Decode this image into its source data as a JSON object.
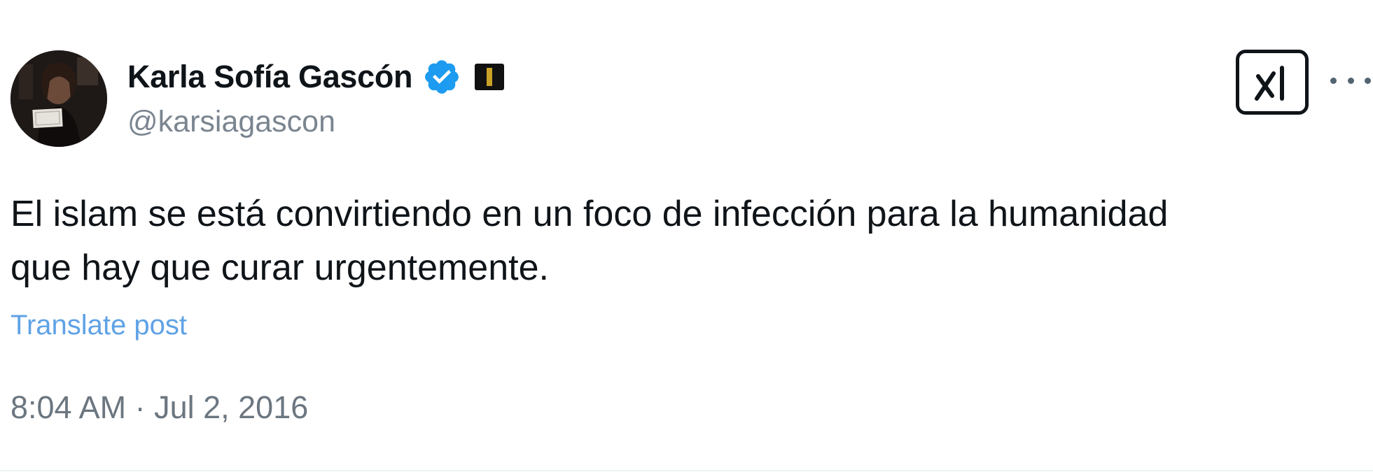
{
  "tweet": {
    "author": {
      "display_name": "Karla Sofía Gascón",
      "handle": "@karsiagascon",
      "verified": true,
      "badge_icon": "verified-badge-icon",
      "affiliate_icon": "flag-icon"
    },
    "text_lines": [
      "El islam se está convirtiendo en un foco de infección para la humanidad",
      "que hay que curar urgentemente."
    ],
    "translate_label": "Translate post",
    "timestamp": "8:04 AM · Jul 2, 2016"
  },
  "actions": {
    "grok_icon": "grok-icon",
    "more_icon": "more-options-icon"
  },
  "colors": {
    "text": "#0f1419",
    "secondary": "#7a8590",
    "link": "#5fa2e6",
    "verified": "#1d9bf0"
  }
}
